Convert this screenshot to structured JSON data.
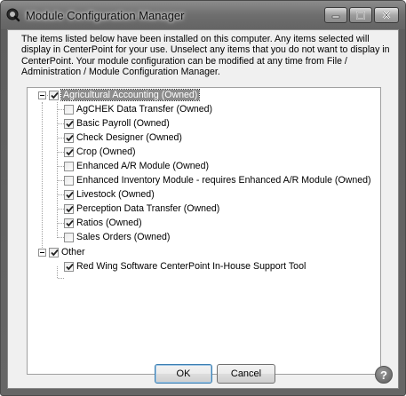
{
  "window": {
    "title": "Module Configuration Manager"
  },
  "description": "The items listed below have been installed on this computer.  Any items selected will display in CenterPoint for your use.  Unselect any items that you do not want to display in CenterPoint.  Your module configuration can be modified at any time from File / Administration / Module Configuration Manager.",
  "tree": {
    "groups": [
      {
        "label": "Agricultural Accounting (Owned)",
        "checked": true,
        "expanded": true,
        "selected": true,
        "items": [
          {
            "label": "AgCHEK Data Transfer (Owned)",
            "checked": false
          },
          {
            "label": "Basic Payroll (Owned)",
            "checked": true
          },
          {
            "label": "Check Designer (Owned)",
            "checked": true
          },
          {
            "label": "Crop (Owned)",
            "checked": true
          },
          {
            "label": "Enhanced A/R Module (Owned)",
            "checked": false
          },
          {
            "label": "Enhanced Inventory Module - requires Enhanced A/R Module (Owned)",
            "checked": false
          },
          {
            "label": "Livestock (Owned)",
            "checked": true
          },
          {
            "label": "Perception Data Transfer (Owned)",
            "checked": true
          },
          {
            "label": "Ratios (Owned)",
            "checked": true
          },
          {
            "label": "Sales Orders (Owned)",
            "checked": false
          }
        ]
      },
      {
        "label": "Other",
        "checked": true,
        "expanded": true,
        "selected": false,
        "items": [
          {
            "label": "Red Wing Software CenterPoint In-House Support Tool",
            "checked": true
          }
        ]
      }
    ]
  },
  "buttons": {
    "ok": "OK",
    "cancel": "Cancel",
    "help": "?"
  }
}
